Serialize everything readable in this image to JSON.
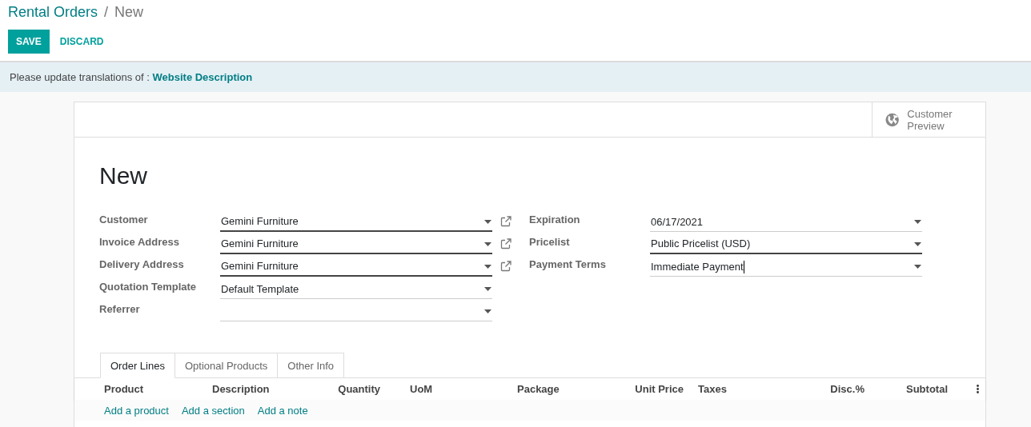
{
  "breadcrumb": [
    {
      "label": "Rental Orders",
      "kind": "link"
    },
    {
      "label": "/",
      "kind": "separator"
    },
    {
      "label": "New",
      "kind": "current"
    }
  ],
  "buttons": [
    {
      "label": "SAVE",
      "kind": "primary"
    },
    {
      "label": "DISCARD",
      "kind": "link"
    }
  ],
  "banner": {
    "text": "Please update translations of : ",
    "link": "Website Description"
  },
  "button_box": [
    {
      "label": "Customer Preview"
    }
  ],
  "title": "New",
  "left_fields": [
    {
      "label": "Customer",
      "value": "Gemini Furniture",
      "required": true,
      "link": true,
      "focused": false
    },
    {
      "label": "Invoice Address",
      "value": "Gemini Furniture",
      "required": true,
      "link": true,
      "focused": false
    },
    {
      "label": "Delivery Address",
      "value": "Gemini Furniture",
      "required": true,
      "link": true,
      "focused": false
    },
    {
      "label": "Quotation Template",
      "value": "Default Template",
      "required": false,
      "link": false,
      "focused": false
    },
    {
      "label": "Referrer",
      "required": false,
      "link": false,
      "focused": false
    }
  ],
  "right_fields": [
    {
      "label": "Expiration",
      "value": "06/17/2021",
      "required": false,
      "link": false,
      "focused": false
    },
    {
      "label": "Pricelist",
      "value": "Public Pricelist (USD)",
      "required": true,
      "link": false,
      "focused": false
    },
    {
      "label": "Payment Terms",
      "value": "Immediate Payment",
      "required": false,
      "link": false,
      "focused": true
    }
  ],
  "tabs": [
    {
      "label": "Order Lines",
      "selected": true
    },
    {
      "label": "Optional Products",
      "selected": false
    },
    {
      "label": "Other Info",
      "selected": false
    }
  ],
  "table": {
    "columns": [
      "Product",
      "Description",
      "Quantity",
      "UoM",
      "Package",
      "Unit Price",
      "Taxes",
      "Disc.%",
      "Subtotal"
    ],
    "add_links": [
      "Add a product",
      "Add a section",
      "Add a note"
    ]
  }
}
